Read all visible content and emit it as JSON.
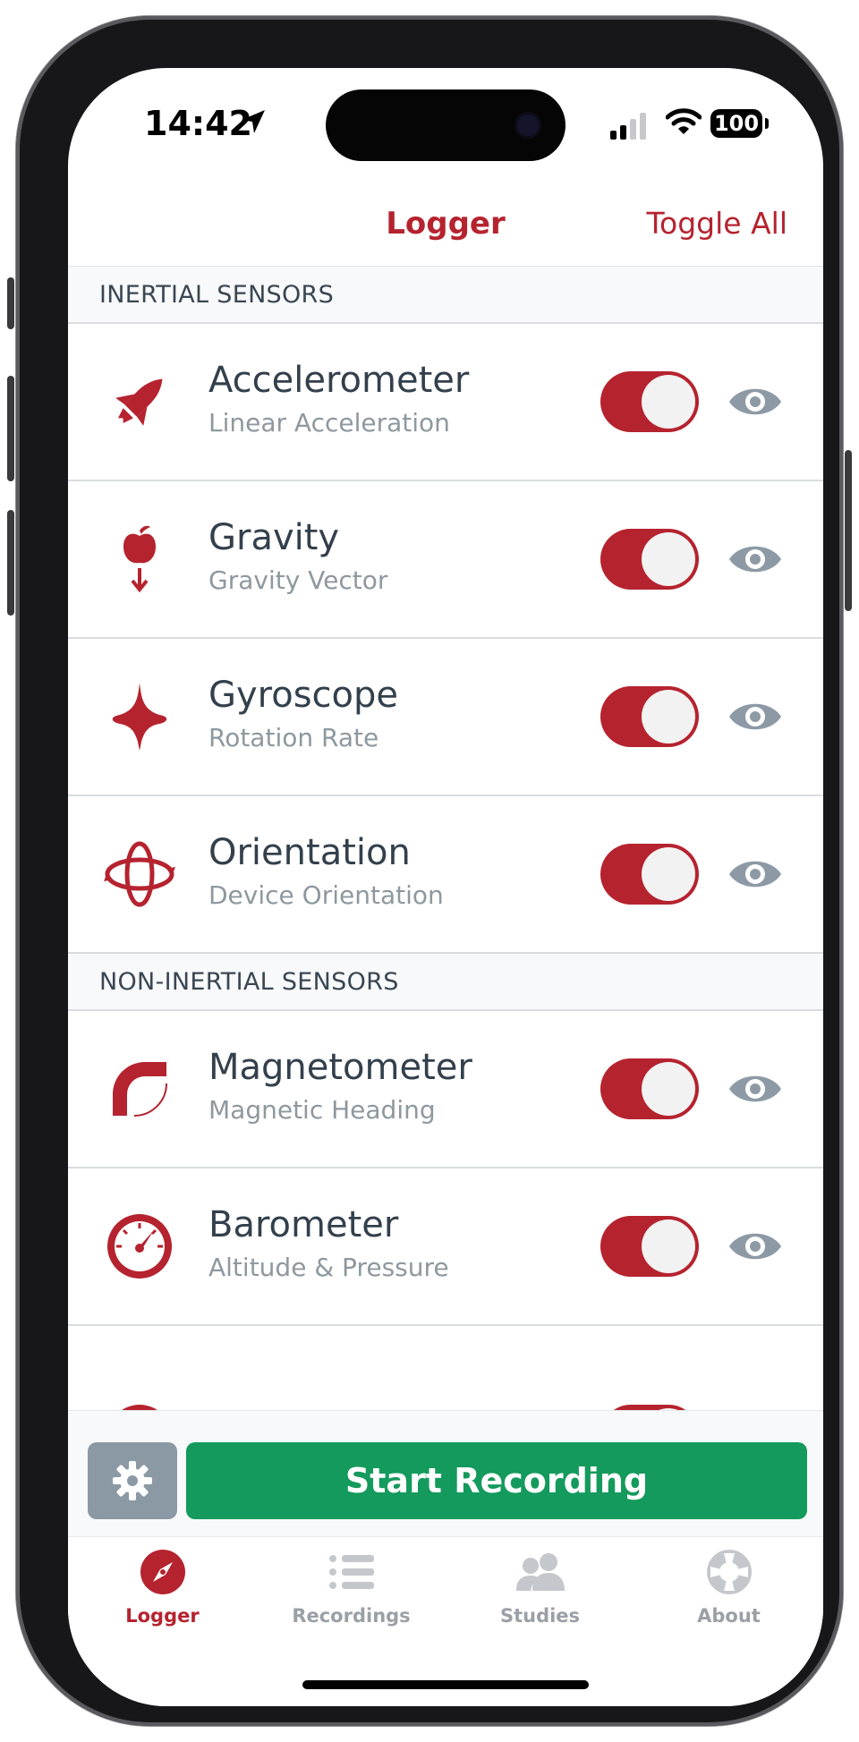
{
  "status_bar": {
    "time": "14:42",
    "battery": "100"
  },
  "nav": {
    "title": "Logger",
    "toggle_all": "Toggle All"
  },
  "sections": [
    {
      "header": "INERTIAL SENSORS"
    },
    {
      "header": "NON-INERTIAL SENSORS"
    }
  ],
  "sensors": [
    {
      "title": "Accelerometer",
      "subtitle": "Linear Acceleration",
      "icon": "rocket-icon",
      "enabled": true
    },
    {
      "title": "Gravity",
      "subtitle": "Gravity Vector",
      "icon": "apple-gravity-icon",
      "enabled": true
    },
    {
      "title": "Gyroscope",
      "subtitle": "Rotation Rate",
      "icon": "spinning-top-icon",
      "enabled": true
    },
    {
      "title": "Orientation",
      "subtitle": "Device Orientation",
      "icon": "rotation-arrows-icon",
      "enabled": true
    },
    {
      "title": "Magnetometer",
      "subtitle": "Magnetic Heading",
      "icon": "magnet-icon",
      "enabled": true
    },
    {
      "title": "Barometer",
      "subtitle": "Altitude & Pressure",
      "icon": "gauge-icon",
      "enabled": true
    }
  ],
  "actions": {
    "start_recording": "Start Recording",
    "settings_icon": "gear-icon"
  },
  "tabs": [
    {
      "label": "Logger",
      "icon": "compass-icon",
      "active": true
    },
    {
      "label": "Recordings",
      "icon": "list-icon",
      "active": false
    },
    {
      "label": "Studies",
      "icon": "people-icon",
      "active": false
    },
    {
      "label": "About",
      "icon": "lifebuoy-icon",
      "active": false
    }
  ],
  "colors": {
    "accent": "#b5232f",
    "start_button": "#149a5c",
    "settings_button": "#8b99a4",
    "eye_icon": "#8d9aa6",
    "inactive_tab": "#9aa0a6"
  }
}
